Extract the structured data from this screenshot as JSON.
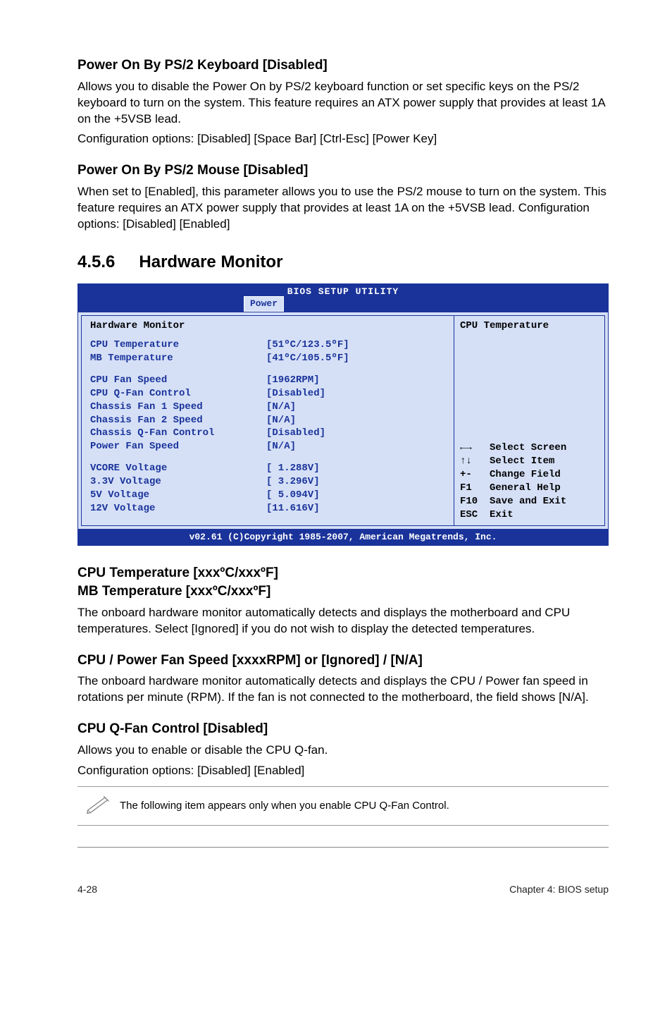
{
  "section1": {
    "heading": "Power On By PS/2 Keyboard [Disabled]",
    "body": "Allows you to disable the Power On by PS/2 keyboard function or set specific keys on the PS/2 keyboard to turn on the system. This feature requires an ATX power supply that provides at least 1A on the +5VSB lead.",
    "config": "Configuration options: [Disabled] [Space Bar] [Ctrl-Esc] [Power Key]"
  },
  "section2": {
    "heading": "Power On By PS/2 Mouse [Disabled]",
    "body": "When set to [Enabled], this parameter allows you to use the PS/2 mouse to turn on the system. This feature requires an ATX power supply that provides at least 1A on the +5VSB lead. Configuration options: [Disabled] [Enabled]"
  },
  "hwmon": {
    "number": "4.5.6",
    "title": "Hardware Monitor"
  },
  "bios": {
    "title": "BIOS SETUP UTILITY",
    "tab": "Power",
    "panel_header": "Hardware Monitor",
    "rows_a": [
      {
        "label": "CPU Temperature",
        "value": "[51ºC/123.5ºF]"
      },
      {
        "label": "MB Temperature",
        "value": "[41ºC/105.5ºF]"
      }
    ],
    "rows_b": [
      {
        "label": "CPU Fan Speed",
        "value": "[1962RPM]"
      },
      {
        "label": "CPU Q-Fan Control",
        "value": "[Disabled]"
      },
      {
        "label": "Chassis Fan 1 Speed",
        "value": "[N/A]"
      },
      {
        "label": "Chassis Fan 2 Speed",
        "value": "[N/A]"
      },
      {
        "label": "Chassis Q-Fan Control",
        "value": "[Disabled]"
      },
      {
        "label": "Power Fan Speed",
        "value": "[N/A]"
      }
    ],
    "rows_c": [
      {
        "label": "VCORE Voltage",
        "value": "[ 1.288V]"
      },
      {
        "label": "3.3V  Voltage",
        "value": "[ 3.296V]"
      },
      {
        "label": "5V    Voltage",
        "value": "[ 5.094V]"
      },
      {
        "label": "12V   Voltage",
        "value": "[11.616V]"
      }
    ],
    "right_top": "CPU Temperature",
    "legend": [
      {
        "sym": "←→",
        "txt": "Select Screen"
      },
      {
        "sym": "↑↓",
        "txt": "Select Item"
      },
      {
        "sym": "+-",
        "txt": "Change Field"
      },
      {
        "sym": "F1",
        "txt": "General Help"
      },
      {
        "sym": "F10",
        "txt": "Save and Exit"
      },
      {
        "sym": "ESC",
        "txt": "Exit"
      }
    ],
    "copyright": "v02.61 (C)Copyright 1985-2007, American Megatrends, Inc."
  },
  "section3": {
    "heading1": "CPU Temperature [xxxºC/xxxºF]",
    "heading2": "MB Temperature [xxxºC/xxxºF]",
    "body": "The onboard hardware monitor automatically detects and displays the motherboard and CPU temperatures. Select [Ignored] if you do not wish to display the detected temperatures."
  },
  "section4": {
    "heading": "CPU / Power Fan Speed [xxxxRPM] or [Ignored] / [N/A]",
    "body": "The onboard hardware monitor automatically detects and displays the CPU / Power fan speed in rotations per minute (RPM). If the fan is not connected to the motherboard, the field shows [N/A]."
  },
  "section5": {
    "heading": "CPU Q-Fan Control [Disabled]",
    "body": "Allows you to enable or disable the CPU Q-fan.",
    "config": "Configuration options: [Disabled] [Enabled]"
  },
  "note": "The following item appears only when you enable CPU Q-Fan Control.",
  "footer": {
    "left": "4-28",
    "right": "Chapter 4: BIOS setup"
  }
}
